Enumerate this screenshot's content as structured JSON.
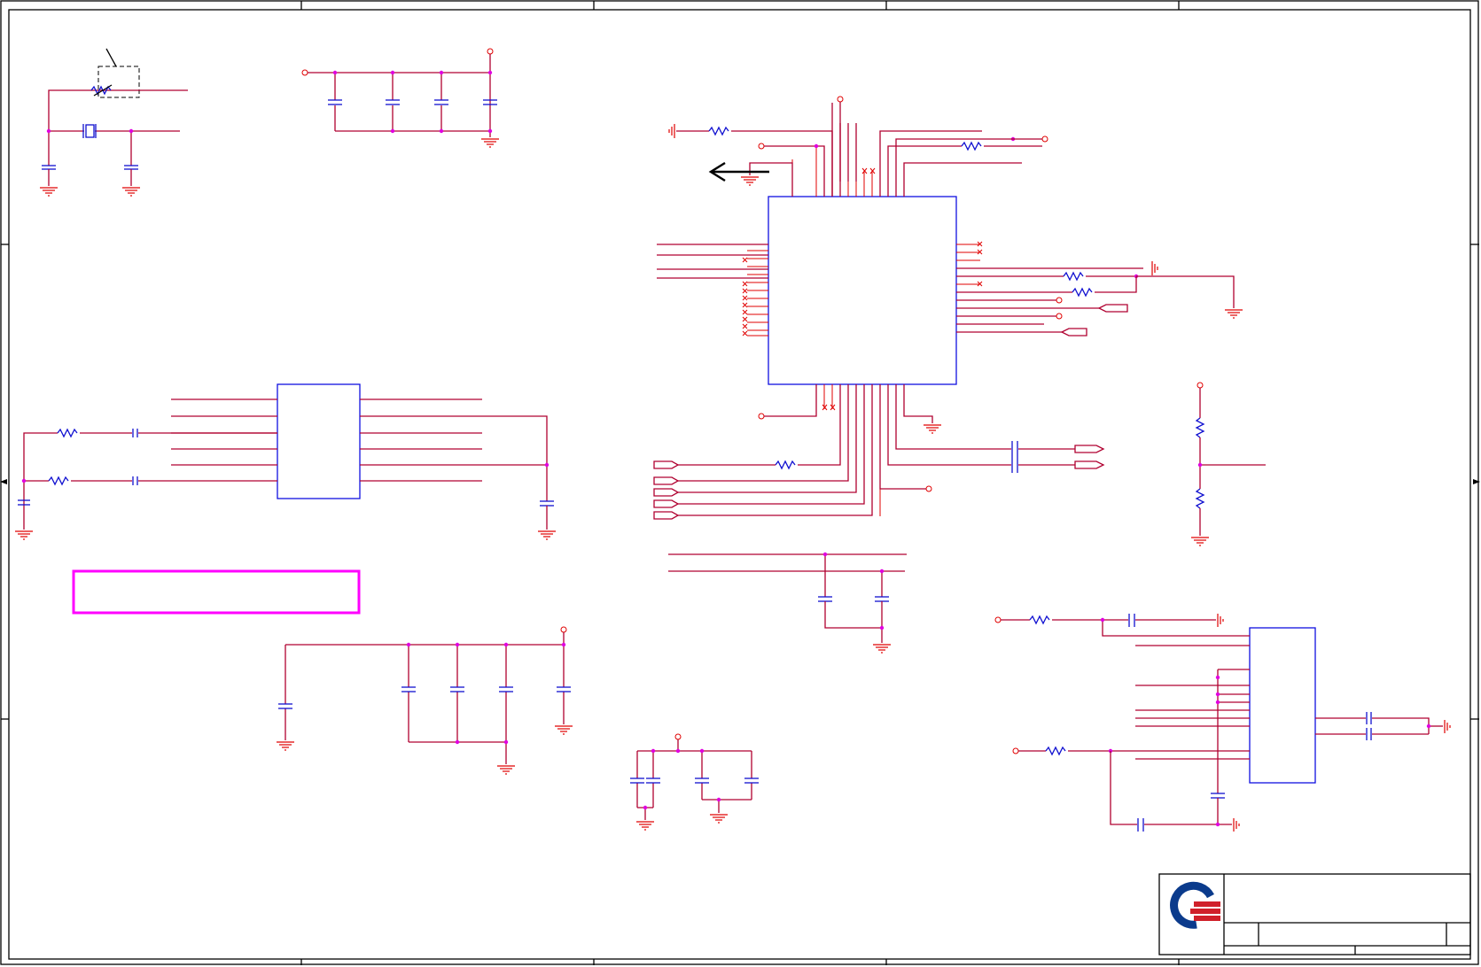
{
  "colors": {
    "wire": "#b00030",
    "pin": "#e00000",
    "component": "#1010e0",
    "junction": "#e000e0",
    "highlight_box": "#ff00ff",
    "border": "#000000",
    "logo_blue": "#0b3b8c",
    "logo_red": "#d0202a"
  },
  "icons": {
    "title_block_logo": "company-logo-icon",
    "pointer": "left-arrow-icon"
  }
}
